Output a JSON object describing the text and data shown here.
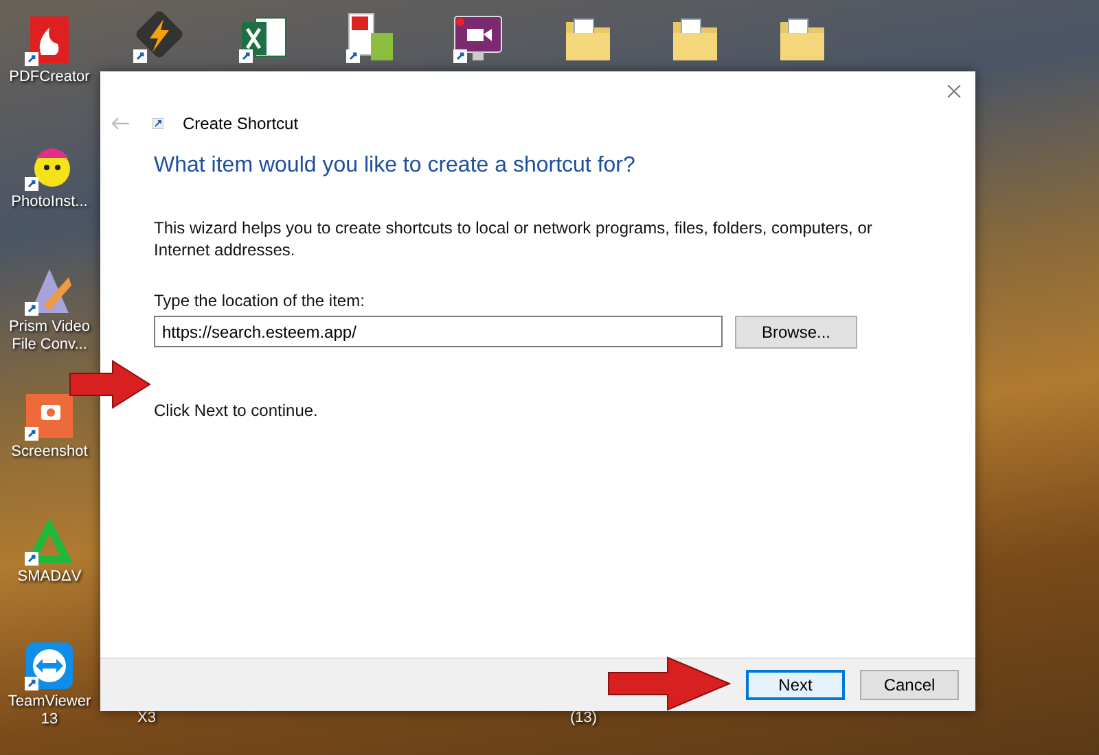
{
  "desktop": {
    "left_icons": [
      {
        "label": "PDFCreator",
        "kind": "pdf"
      },
      {
        "label": "PhotoInst...",
        "kind": "smiley"
      },
      {
        "label": "Prism Video File Conv...",
        "kind": "prism"
      },
      {
        "label": "Screenshot",
        "kind": "camera"
      },
      {
        "label": "SMADΔV",
        "kind": "triangle"
      },
      {
        "label": "TeamViewer 13",
        "kind": "teamviewer"
      }
    ],
    "hidden_labels": [
      {
        "label": "X3"
      },
      {
        "label": "(13)"
      }
    ]
  },
  "dialog": {
    "title": "Create Shortcut",
    "heading": "What item would you like to create a shortcut for?",
    "description": "This wizard helps you to create shortcuts to local or network programs, files, folders, computers, or Internet addresses.",
    "location_label": "Type the location of the item:",
    "location_value": "https://search.esteem.app/",
    "browse_button": "Browse...",
    "hint": "Click Next to continue.",
    "buttons": [
      {
        "label": "Next",
        "selected": true
      },
      {
        "label": "Cancel",
        "selected": false
      }
    ]
  }
}
